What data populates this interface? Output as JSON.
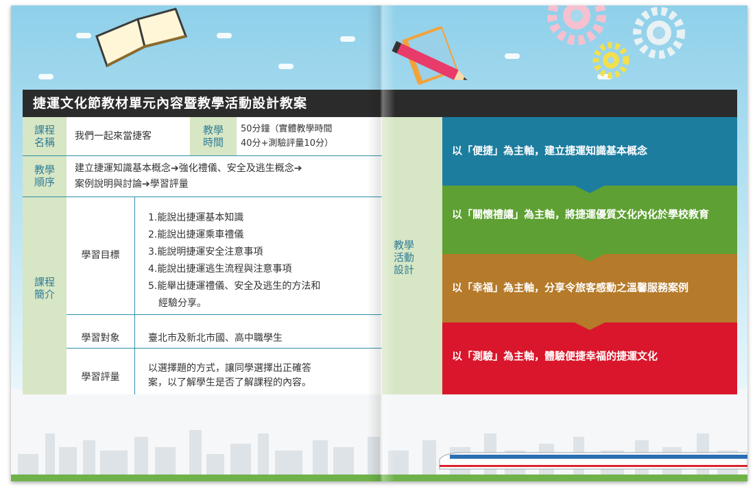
{
  "title": "捷運文化節教材單元內容暨教學活動設計教案",
  "course_name": {
    "label": "課程\n名稱",
    "value": "我們一起來當捷客"
  },
  "teaching_time": {
    "label": "教學\n時間",
    "value_line1": "50分鐘（實體教學時間",
    "value_line2": "40分+測驗評量10分）"
  },
  "teaching_order": {
    "label": "教學\n順序",
    "line1": "建立捷運知識基本概念➔強化禮儀、安全及逃生概念➔",
    "line2": "案例說明與討論➔學習評量"
  },
  "course_intro": {
    "label": "課程\n簡介"
  },
  "learning_goals": {
    "label": "學習目標",
    "items": [
      "1.能說出捷運基本知識",
      "2.能說出捷運乘車禮儀",
      "3.能說明捷運安全注意事項",
      "4.能說出捷運逃生流程與注意事項",
      "5.能舉出捷運禮儀、安全及逃生的方法和"
    ],
    "item5_cont": "經驗分享。"
  },
  "learning_target": {
    "label": "學習對象",
    "value": "臺北市及新北市國、高中職學生"
  },
  "learning_assessment": {
    "label": "學習評量",
    "line1": "以選擇題的方式，讓同學選擇出正確答",
    "line2": "案，以了解學生是否了解課程的內容。"
  },
  "activity_design": {
    "label": "教學\n活動\n設計"
  },
  "activities": [
    {
      "text": "以「便捷」為主軸，建立捷運知識基本概念",
      "color": "#1c7d9f"
    },
    {
      "text": "以「關懷禮讓」為主軸，將捷運優質文化內化於學校教育",
      "color": "#5ea033"
    },
    {
      "text": "以「幸福」為主軸，分享令旅客感動之溫馨服務案例",
      "color": "#b57a2a"
    },
    {
      "text": "以「測驗」為主軸，體驗便捷幸福的捷運文化",
      "color": "#d9162b"
    }
  ]
}
